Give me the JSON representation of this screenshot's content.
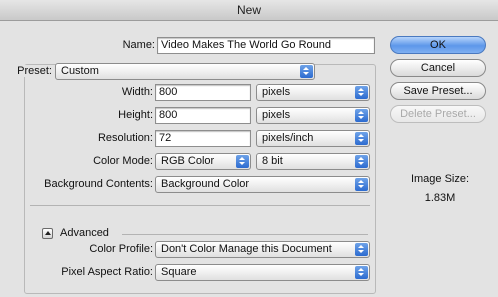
{
  "window": {
    "title": "New"
  },
  "name": {
    "label": "Name:",
    "value": "Video Makes The World Go Round"
  },
  "preset": {
    "label": "Preset:",
    "value": "Custom"
  },
  "width": {
    "label": "Width:",
    "value": "800",
    "unit": "pixels"
  },
  "height": {
    "label": "Height:",
    "value": "800",
    "unit": "pixels"
  },
  "resolution": {
    "label": "Resolution:",
    "value": "72",
    "unit": "pixels/inch"
  },
  "color_mode": {
    "label": "Color Mode:",
    "value": "RGB Color",
    "depth": "8 bit"
  },
  "background": {
    "label": "Background Contents:",
    "value": "Background Color"
  },
  "advanced": {
    "label": "Advanced"
  },
  "color_profile": {
    "label": "Color Profile:",
    "value": "Don't Color Manage this Document"
  },
  "pixel_aspect": {
    "label": "Pixel Aspect Ratio:",
    "value": "Square"
  },
  "buttons": {
    "ok": "OK",
    "cancel": "Cancel",
    "save_preset": "Save Preset...",
    "delete_preset": "Delete Preset..."
  },
  "image_size": {
    "label": "Image Size:",
    "value": "1.83M"
  },
  "colors": {
    "default_button": "#5d97ea",
    "select_arrow": "#2c6bd0"
  }
}
